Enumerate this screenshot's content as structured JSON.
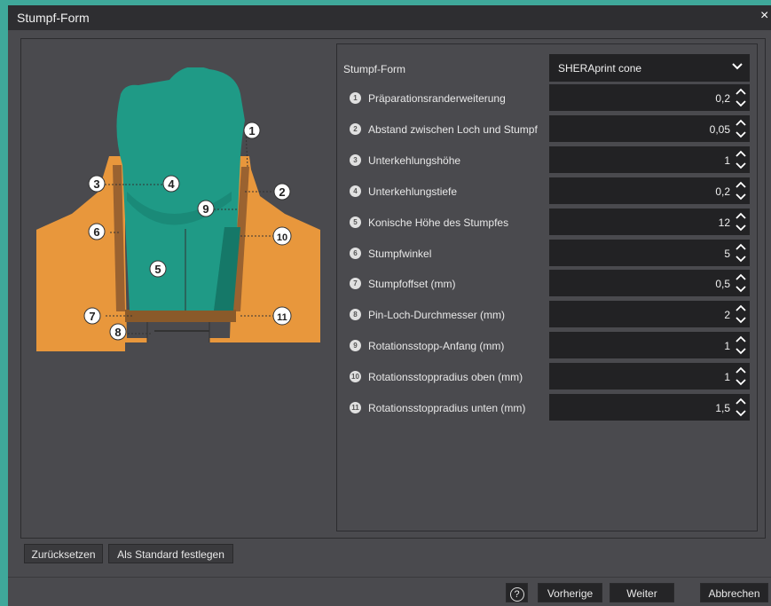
{
  "window": {
    "title": "Stumpf-Form",
    "close": "×"
  },
  "form": {
    "shape_label": "Stumpf-Form",
    "shape_value": "SHERAprint cone",
    "rows": [
      {
        "num": "1",
        "label": "Präparationsranderweiterung",
        "value": "0,2"
      },
      {
        "num": "2",
        "label": "Abstand zwischen Loch und Stumpf",
        "value": "0,05"
      },
      {
        "num": "3",
        "label": "Unterkehlungshöhe",
        "value": "1"
      },
      {
        "num": "4",
        "label": "Unterkehlungstiefe",
        "value": "0,2"
      },
      {
        "num": "5",
        "label": "Konische Höhe des Stumpfes",
        "value": "12"
      },
      {
        "num": "6",
        "label": "Stumpfwinkel",
        "value": "5"
      },
      {
        "num": "7",
        "label": "Stumpfoffset (mm)",
        "value": "0,5"
      },
      {
        "num": "8",
        "label": "Pin-Loch-Durchmesser (mm)",
        "value": "2"
      },
      {
        "num": "9",
        "label": "Rotationsstopp-Anfang (mm)",
        "value": "1"
      },
      {
        "num": "10",
        "label": "Rotationsstoppradius oben (mm)",
        "value": "1"
      },
      {
        "num": "11",
        "label": "Rotationsstoppradius unten (mm)",
        "value": "1,5"
      }
    ]
  },
  "illustration": {
    "markers": [
      "1",
      "2",
      "3",
      "4",
      "5",
      "6",
      "7",
      "8",
      "9",
      "10",
      "11"
    ],
    "colors": {
      "tooth": "#1f9a86",
      "base": "#e8973c",
      "socket": "#8a5a2a"
    }
  },
  "buttons": {
    "reset": "Zurücksetzen",
    "set_default": "Als Standard festlegen",
    "help": "?",
    "previous": "Vorherige",
    "next": "Weiter",
    "cancel": "Abbrechen"
  }
}
